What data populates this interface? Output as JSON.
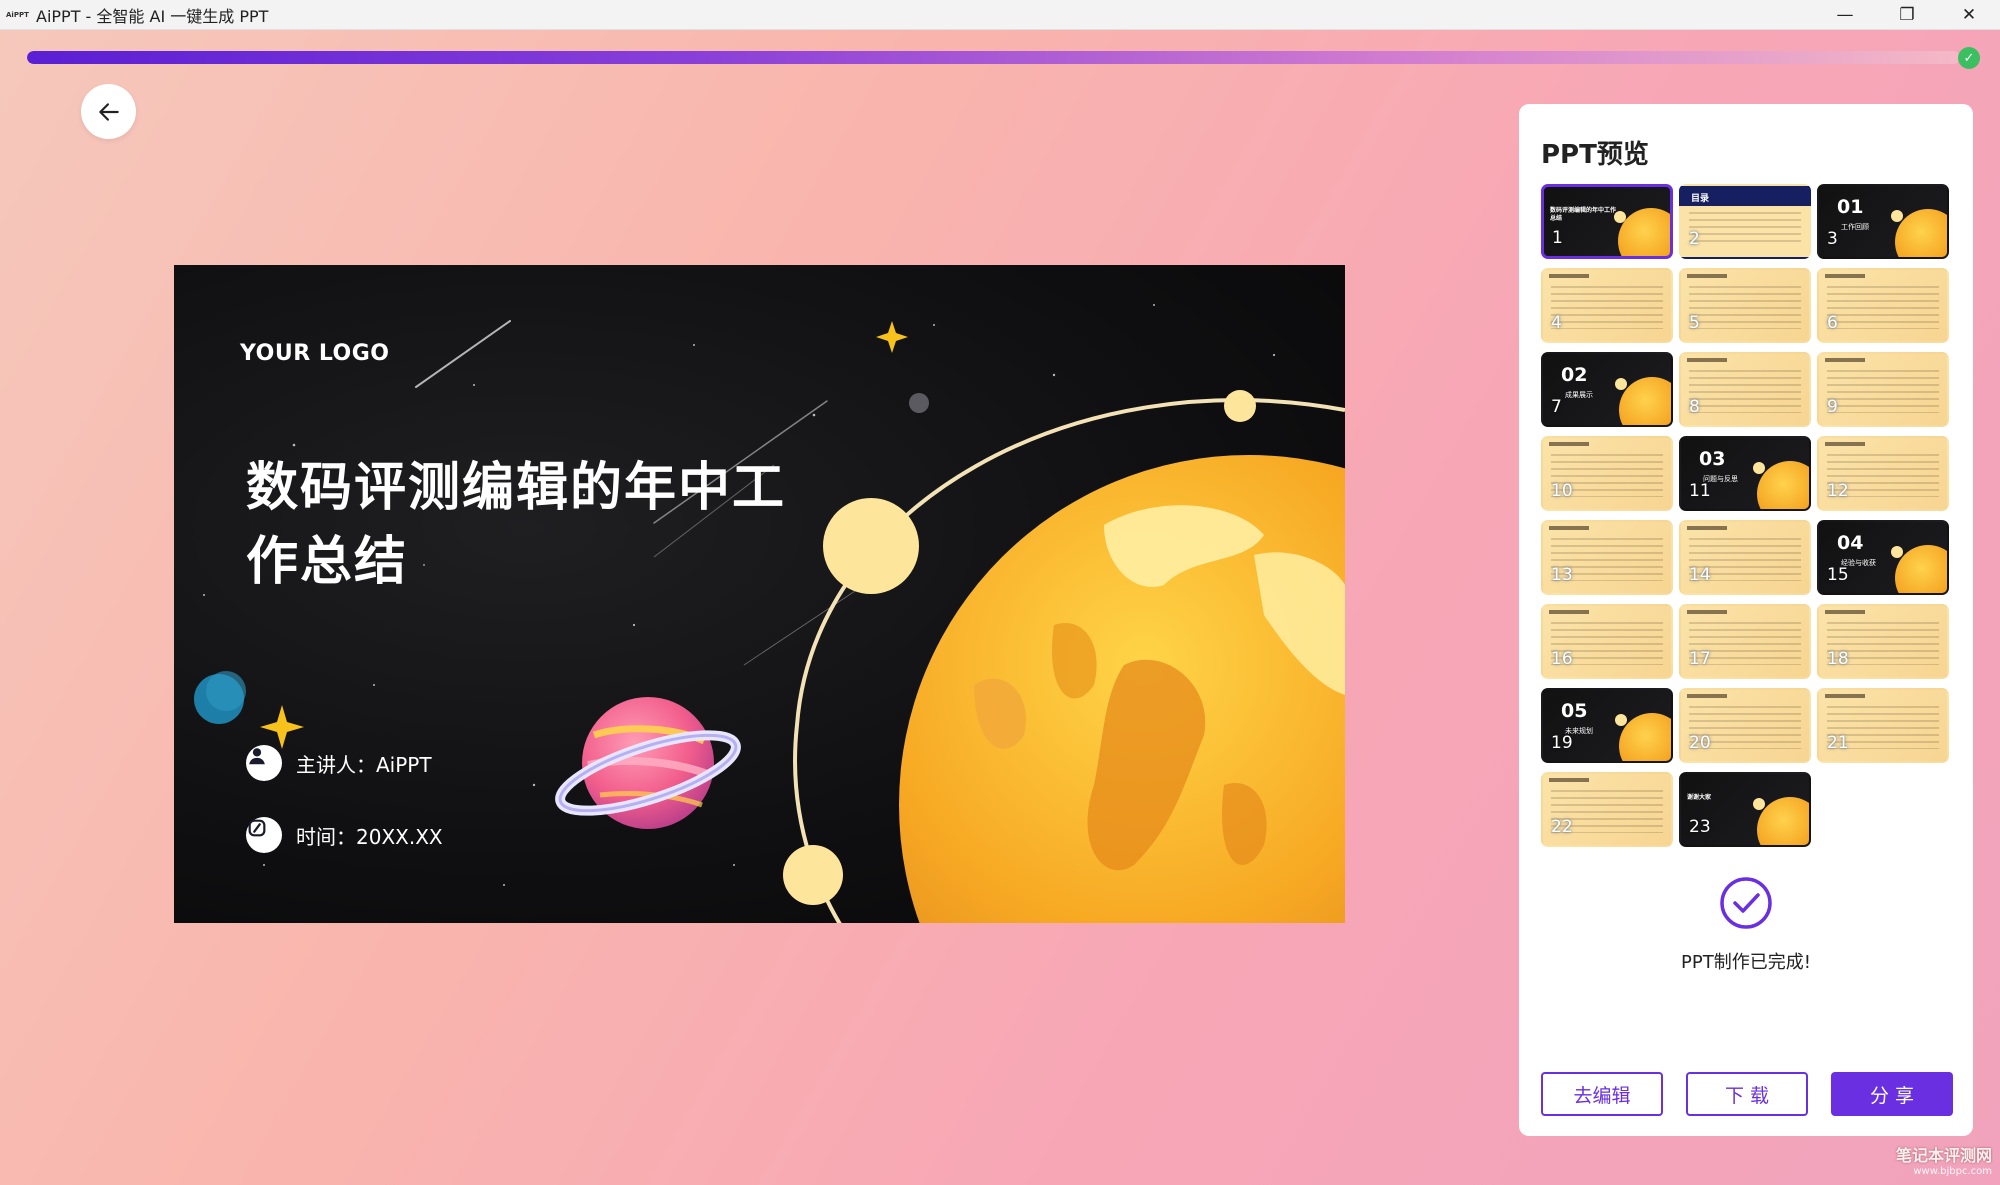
{
  "window": {
    "app_icon_text": "AiPPT",
    "title": "AiPPT - 全智能 AI 一键生成 PPT",
    "minimize_glyph": "—",
    "maximize_glyph": "❐",
    "close_glyph": "✕"
  },
  "progress": {
    "percent": 100,
    "status_icon": "check-icon"
  },
  "back_button": {
    "icon": "arrow-left-icon"
  },
  "slide": {
    "logo": "YOUR LOGO",
    "title": "数码评测编辑的年中工作总结",
    "presenter": "主讲人：AiPPT",
    "time": "时间：20XX.XX",
    "colors": {
      "background": "#0f0f11",
      "planet": "#f5a623",
      "accent": "#fde59b"
    }
  },
  "panel": {
    "title": "PPT预览",
    "thumbnails": [
      {
        "num": "1",
        "style": "dark",
        "title": "数码评测编辑的年中工作总结",
        "selected": true
      },
      {
        "num": "2",
        "style": "navy",
        "label": "目录"
      },
      {
        "num": "3",
        "style": "dark",
        "chapter": "01",
        "caption": "工作回顾"
      },
      {
        "num": "4",
        "style": "light"
      },
      {
        "num": "5",
        "style": "light"
      },
      {
        "num": "6",
        "style": "light"
      },
      {
        "num": "7",
        "style": "dark",
        "chapter": "02",
        "caption": "成果展示"
      },
      {
        "num": "8",
        "style": "light"
      },
      {
        "num": "9",
        "style": "light"
      },
      {
        "num": "10",
        "style": "light"
      },
      {
        "num": "11",
        "style": "dark",
        "chapter": "03",
        "caption": "问题与反思"
      },
      {
        "num": "12",
        "style": "light"
      },
      {
        "num": "13",
        "style": "light"
      },
      {
        "num": "14",
        "style": "light"
      },
      {
        "num": "15",
        "style": "dark",
        "chapter": "04",
        "caption": "经验与收获"
      },
      {
        "num": "16",
        "style": "light"
      },
      {
        "num": "17",
        "style": "light"
      },
      {
        "num": "18",
        "style": "light"
      },
      {
        "num": "19",
        "style": "dark",
        "chapter": "05",
        "caption": "未来规划"
      },
      {
        "num": "20",
        "style": "light"
      },
      {
        "num": "21",
        "style": "light"
      },
      {
        "num": "22",
        "style": "light"
      },
      {
        "num": "23",
        "style": "dark",
        "title": "谢谢大家"
      }
    ],
    "done_text": "PPT制作已完成!",
    "buttons": {
      "edit": "去编辑",
      "download": "下 载",
      "share": "分 享"
    },
    "accent_color": "#6a2fe0"
  },
  "watermark": {
    "line1": "笔记本评测网",
    "line2": "www.bjbpc.com"
  }
}
